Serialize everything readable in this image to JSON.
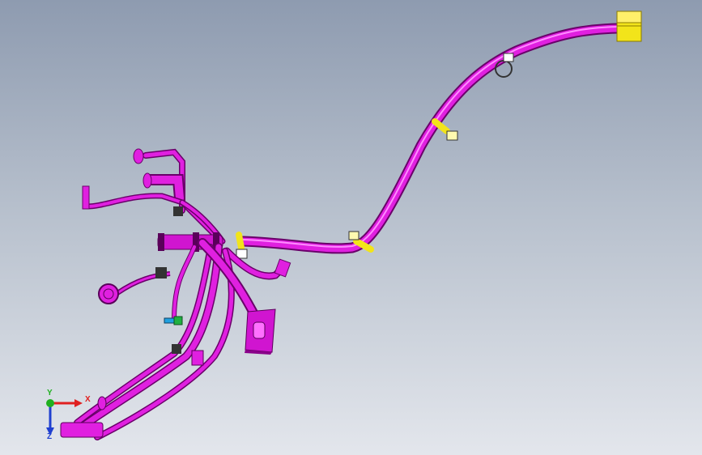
{
  "viewport": {
    "part_color": "#e020e0",
    "part_edge": "#7a007a",
    "clip_color": "#f0e010",
    "background_top": "#8e9bb0",
    "background_bottom": "#e3e6ec"
  },
  "triad": {
    "x_label": "X",
    "y_label": "Y",
    "z_label": "Z",
    "x_color": "#e02020",
    "y_color": "#20b020",
    "z_color": "#2040d0"
  }
}
